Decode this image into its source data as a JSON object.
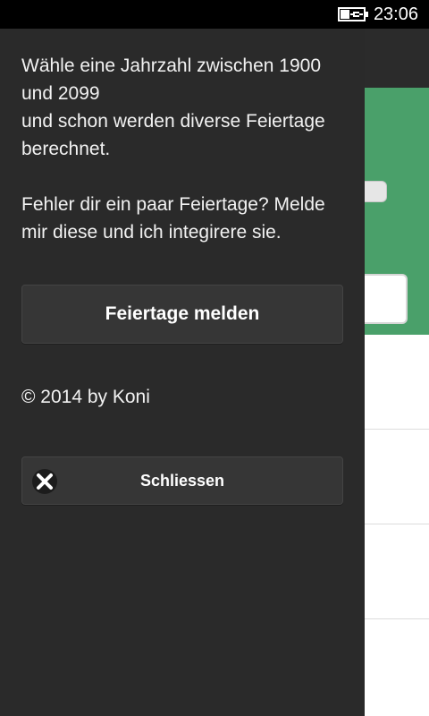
{
  "status_bar": {
    "time": "23:06",
    "battery_icon": "battery-charging-icon"
  },
  "panel": {
    "info_text": "Wähle eine Jahrzahl zwischen 1900 und 2099\nund schon werden diverse Feiertage berechnet.\n\nFehler dir ein paar Feiertage? Melde mir diese und ich integirere sie.",
    "report_button_label": "Feiertage melden",
    "copyright": "© 2014 by Koni",
    "close_button_label": "Schliessen",
    "close_icon": "close-icon"
  },
  "colors": {
    "panel_bg": "#2a2a2a",
    "button_bg": "#363636",
    "accent_green": "#4aa06a",
    "header_dark": "#2b2b2b"
  }
}
